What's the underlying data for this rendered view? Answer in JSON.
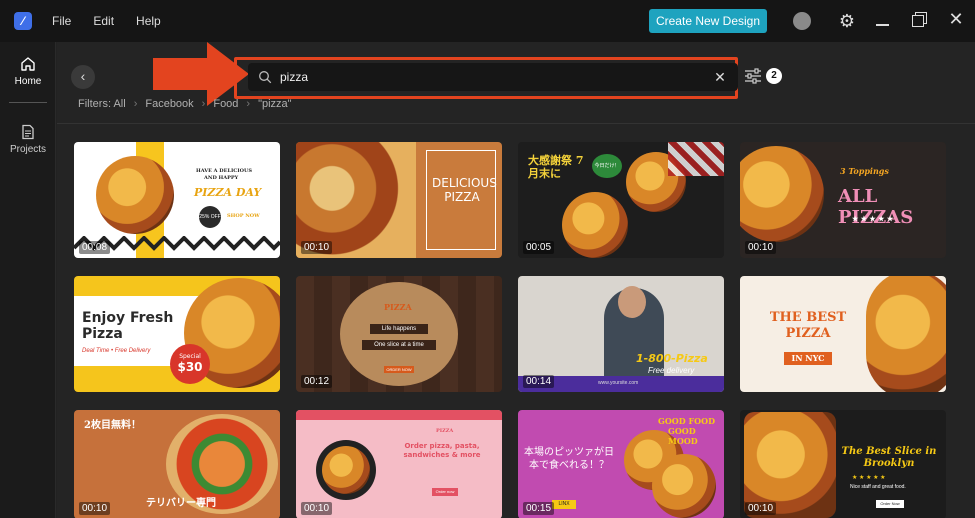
{
  "app": {
    "menu": [
      "File",
      "Edit",
      "Help"
    ],
    "create_button": "Create New Design"
  },
  "sidebar": {
    "home_label": "Home",
    "projects_label": "Projects"
  },
  "search": {
    "value": "pizza",
    "filter_count": "2"
  },
  "breadcrumb": {
    "filters": "Filters: All",
    "items": [
      "Facebook",
      "Food",
      "\"pizza\""
    ]
  },
  "templates": [
    {
      "duration": "00:08",
      "title": "PIZZA DAY",
      "lines": [
        "HAVE A DELICIOUS",
        "AND HAPPY",
        "25% OFF",
        "SHOP NOW"
      ]
    },
    {
      "duration": "00:10",
      "title": "DELICIOUS PIZZA"
    },
    {
      "duration": "00:05",
      "title": "大感謝祭 7月末に",
      "lines": [
        "今日だけ！",
        "NEW"
      ]
    },
    {
      "duration": "00:10",
      "title": "ALL PIZZAS",
      "lines": [
        "3 Toppings",
        "★ ★ ★ ★ ★"
      ]
    },
    {
      "duration": "",
      "title": "Enjoy Fresh Pizza",
      "lines": [
        "Deal Time • Free Delivery",
        "Special",
        "$30"
      ]
    },
    {
      "duration": "00:12",
      "title": "PIZZA",
      "lines": [
        "Life happens",
        "One slice at a time",
        "ORDER NOW"
      ]
    },
    {
      "duration": "00:14",
      "title": "1-800-Pizza",
      "lines": [
        "Free delivery",
        "www.yoursite.com"
      ]
    },
    {
      "duration": "",
      "title": "THE BEST PIZZA",
      "lines": [
        "IN NYC"
      ]
    },
    {
      "duration": "00:10",
      "title": "2枚目無料！",
      "lines": [
        "テリバリー専門"
      ]
    },
    {
      "duration": "00:10",
      "title": "Order pizza, pasta, sandwiches & more",
      "lines": [
        "PIZZA",
        "Order now"
      ]
    },
    {
      "duration": "00:15",
      "title": "本場のピッツァが日本で食べれる！？",
      "lines": [
        "GOOD FOOD",
        "GOOD MOOD",
        "LINX"
      ]
    },
    {
      "duration": "00:10",
      "title": "The Best Slice in Brooklyn",
      "lines": [
        "★ ★ ★ ★ ★",
        "Nice staff and great food.",
        "Order Now"
      ]
    }
  ]
}
